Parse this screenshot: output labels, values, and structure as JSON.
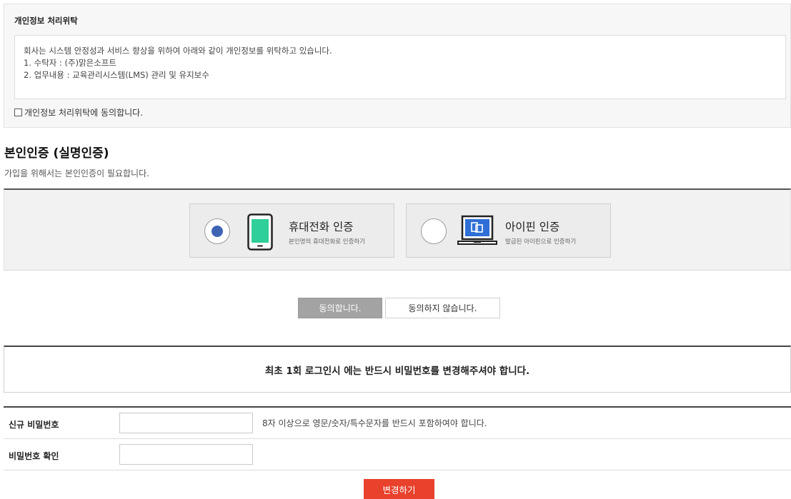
{
  "consent": {
    "title": "개인정보 처리위탁",
    "body_line1": "회사는 시스템 안정성과 서비스 향상을 위하여 아래와 같이 개인정보를 위탁하고 있습니다.",
    "body_line2": "1. 수탁자 : (주)맑은소프트",
    "body_line3": "2. 업무내용 : 교육관리시스템(LMS) 관리 및 유지보수",
    "checkbox_label": "개인정보 처리위탁에 동의합니다.",
    "checked": false
  },
  "verification": {
    "title": "본인인증 (실명인증)",
    "description": "가입을 위해서는 본인인증이 필요합니다.",
    "options": [
      {
        "title": "휴대전화 인증",
        "subtitle": "본인명의 휴대전화로 인증하기",
        "icon": "mobile-phone-icon",
        "selected": true
      },
      {
        "title": "아이핀 인증",
        "subtitle": "발급된 아이핀으로 인증하기",
        "icon": "laptop-icon",
        "selected": false
      }
    ]
  },
  "agreement": {
    "agree_label": "동의합니다.",
    "disagree_label": "동의하지 않습니다."
  },
  "notice": {
    "text": "최초 1회 로그인시 에는 반드시 비밀번호를 변경해주셔야 합니다."
  },
  "password": {
    "new_label": "신규 비밀번호",
    "new_value": "",
    "hint": "8자 이상으로 영문/숫자/특수문자를 반드시 포함하여야 합니다.",
    "confirm_label": "비밀번호 확인",
    "confirm_value": ""
  },
  "submit_label": "변경하기",
  "colors": {
    "accent_red": "#e8412c",
    "radio_blue": "#3f63b3",
    "phone_screen": "#2ecf9a",
    "laptop_screen": "#2f6fd6"
  }
}
